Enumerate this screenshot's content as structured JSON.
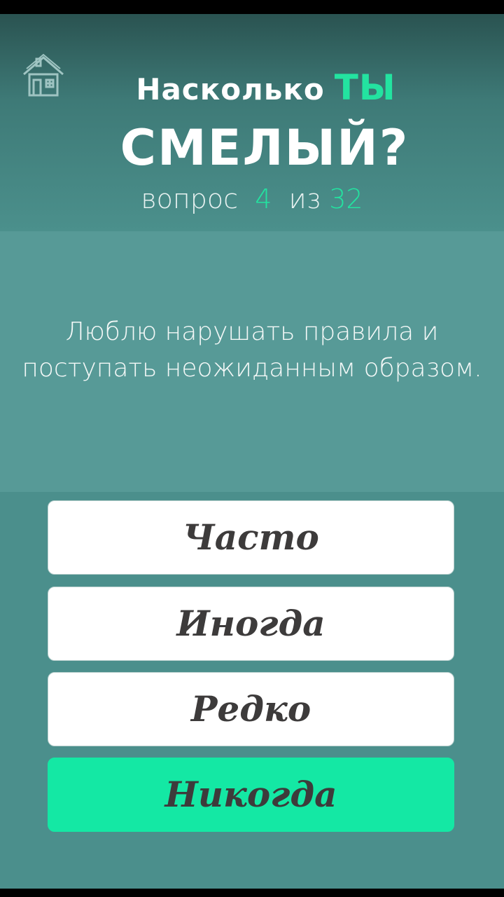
{
  "header": {
    "title_part1": "Насколько",
    "title_accent": "ТЫ",
    "title_part2": "СМЕЛЫЙ?",
    "progress_prefix": "вопрос",
    "current_question": "4",
    "progress_separator": "из",
    "total_questions": "32",
    "home_icon": "home-icon"
  },
  "question": {
    "line1": "Люблю нарушать правила и",
    "line2": "поступать неожиданным образом."
  },
  "answers": [
    {
      "label": "Часто",
      "selected": false
    },
    {
      "label": "Иногда",
      "selected": false
    },
    {
      "label": "Редко",
      "selected": false
    },
    {
      "label": "Никогда",
      "selected": true
    }
  ],
  "colors": {
    "accent": "#23e3a0",
    "selected_answer": "#14e8a4",
    "background": "#4b8f8c"
  }
}
